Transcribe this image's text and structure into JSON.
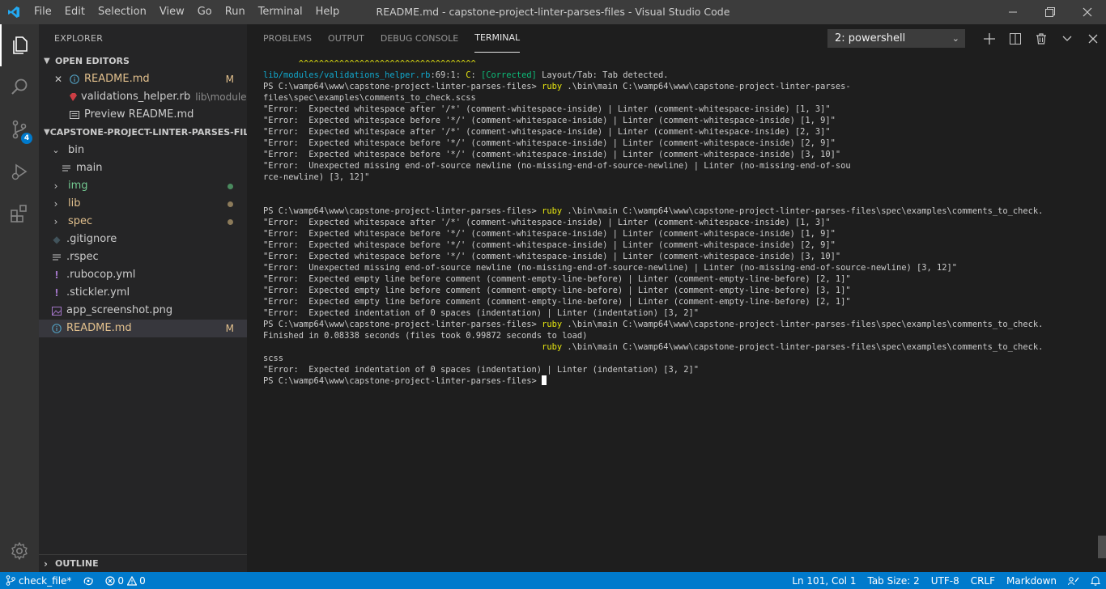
{
  "window": {
    "title": "README.md - capstone-project-linter-parses-files - Visual Studio Code",
    "menu": [
      "File",
      "Edit",
      "Selection",
      "View",
      "Go",
      "Run",
      "Terminal",
      "Help"
    ]
  },
  "activity": {
    "scm_badge": "4"
  },
  "explorer": {
    "header": "EXPLORER",
    "open_editors": {
      "title": "OPEN EDITORS",
      "items": [
        {
          "name": "README.md",
          "status": "M"
        },
        {
          "name": "validations_helper.rb",
          "desc": "lib\\modules"
        },
        {
          "name": "Preview README.md"
        }
      ]
    },
    "project": {
      "title": "CAPSTONE-PROJECT-LINTER-PARSES-FILES",
      "items": [
        "bin",
        "main",
        "img",
        "lib",
        "spec",
        ".gitignore",
        ".rspec",
        ".rubocop.yml",
        ".stickler.yml",
        "app_screenshot.png",
        "README.md"
      ],
      "readme_status": "M"
    },
    "outline": "OUTLINE"
  },
  "panel": {
    "tabs": [
      "PROBLEMS",
      "OUTPUT",
      "DEBUG CONSOLE",
      "TERMINAL"
    ],
    "active_tab": "TERMINAL",
    "terminal_select": "2: powershell"
  },
  "terminal": {
    "lines": [
      [
        {
          "t": "       ^^^^^^^^^^^^^^^^^^^^^^^^^^^^^^^^^^^",
          "c": "y"
        }
      ],
      [
        {
          "t": "lib/modules/validations_helper.rb",
          "c": "c"
        },
        {
          "t": ":69:1: "
        },
        {
          "t": "C",
          "c": "y"
        },
        {
          "t": ": "
        },
        {
          "t": "[Corrected]",
          "c": "g"
        },
        {
          "t": " Layout/Tab: Tab detected."
        }
      ],
      [
        {
          "t": "PS C:\\wamp64\\www\\capstone-project-linter-parses-files> "
        },
        {
          "t": "ruby",
          "c": "y"
        },
        {
          "t": " .\\bin\\main C:\\wamp64\\www\\capstone-project-linter-parses-"
        }
      ],
      [
        {
          "t": "files\\spec\\examples\\comments_to_check.scss"
        }
      ],
      [
        {
          "t": "\"Error:  Expected whitespace after '/*' (comment-whitespace-inside) | Linter (comment-whitespace-inside) [1, 3]\""
        }
      ],
      [
        {
          "t": "\"Error:  Expected whitespace before '*/' (comment-whitespace-inside) | Linter (comment-whitespace-inside) [1, 9]\""
        }
      ],
      [
        {
          "t": "\"Error:  Expected whitespace after '/*' (comment-whitespace-inside) | Linter (comment-whitespace-inside) [2, 3]\""
        }
      ],
      [
        {
          "t": "\"Error:  Expected whitespace before '*/' (comment-whitespace-inside) | Linter (comment-whitespace-inside) [2, 9]\""
        }
      ],
      [
        {
          "t": "\"Error:  Expected whitespace before '*/' (comment-whitespace-inside) | Linter (comment-whitespace-inside) [3, 10]\""
        }
      ],
      [
        {
          "t": "\"Error:  Unexpected missing end-of-source newline (no-missing-end-of-source-newline) | Linter (no-missing-end-of-sou"
        }
      ],
      [
        {
          "t": "rce-newline) [3, 12]\""
        }
      ],
      [
        {
          "t": ""
        }
      ],
      [
        {
          "t": ""
        }
      ],
      [
        {
          "t": "PS C:\\wamp64\\www\\capstone-project-linter-parses-files> "
        },
        {
          "t": "ruby",
          "c": "y"
        },
        {
          "t": " .\\bin\\main C:\\wamp64\\www\\capstone-project-linter-parses-files\\spec\\examples\\comments_to_check."
        }
      ],
      [
        {
          "t": "\"Error:  Expected whitespace after '/*' (comment-whitespace-inside) | Linter (comment-whitespace-inside) [1, 3]\""
        }
      ],
      [
        {
          "t": "\"Error:  Expected whitespace before '*/' (comment-whitespace-inside) | Linter (comment-whitespace-inside) [1, 9]\""
        }
      ],
      [
        {
          "t": "\"Error:  Expected whitespace before '*/' (comment-whitespace-inside) | Linter (comment-whitespace-inside) [2, 9]\""
        }
      ],
      [
        {
          "t": "\"Error:  Expected whitespace before '*/' (comment-whitespace-inside) | Linter (comment-whitespace-inside) [3, 10]\""
        }
      ],
      [
        {
          "t": "\"Error:  Unexpected missing end-of-source newline (no-missing-end-of-source-newline) | Linter (no-missing-end-of-source-newline) [3, 12]\""
        }
      ],
      [
        {
          "t": "\"Error:  Expected empty line before comment (comment-empty-line-before) | Linter (comment-empty-line-before) [2, 1]\""
        }
      ],
      [
        {
          "t": "\"Error:  Expected empty line before comment (comment-empty-line-before) | Linter (comment-empty-line-before) [3, 1]\""
        }
      ],
      [
        {
          "t": "\"Error:  Expected empty line before comment (comment-empty-line-before) | Linter (comment-empty-line-before) [2, 1]\""
        }
      ],
      [
        {
          "t": "\"Error:  Expected indentation of 0 spaces (indentation) | Linter (indentation) [3, 2]\""
        }
      ],
      [
        {
          "t": "PS C:\\wamp64\\www\\capstone-project-linter-parses-files> "
        },
        {
          "t": "ruby",
          "c": "y"
        },
        {
          "t": " .\\bin\\main C:\\wamp64\\www\\capstone-project-linter-parses-files\\spec\\examples\\comments_to_check."
        }
      ],
      [
        {
          "t": "Finished in 0.08338 seconds (files took 0.99872 seconds to load)"
        }
      ],
      [
        {
          "t": "                                                       "
        },
        {
          "t": "ruby",
          "c": "y"
        },
        {
          "t": " .\\bin\\main C:\\wamp64\\www\\capstone-project-linter-parses-files\\spec\\examples\\comments_to_check."
        }
      ],
      [
        {
          "t": "scss"
        }
      ],
      [
        {
          "t": "\"Error:  Expected indentation of 0 spaces (indentation) | Linter (indentation) [3, 2]\""
        }
      ],
      [
        {
          "t": "PS C:\\wamp64\\www\\capstone-project-linter-parses-files> "
        }
      ]
    ]
  },
  "status": {
    "branch": "check_file*",
    "errors": "0",
    "warnings": "0",
    "position": "Ln 101, Col 1",
    "tab_size": "Tab Size: 2",
    "encoding": "UTF-8",
    "eol": "CRLF",
    "language": "Markdown"
  },
  "colors": {
    "accent": "#007acc",
    "git_modified": "#e2c08d",
    "git_untracked": "#73c991",
    "lib_dot": "#8c7b5a"
  }
}
